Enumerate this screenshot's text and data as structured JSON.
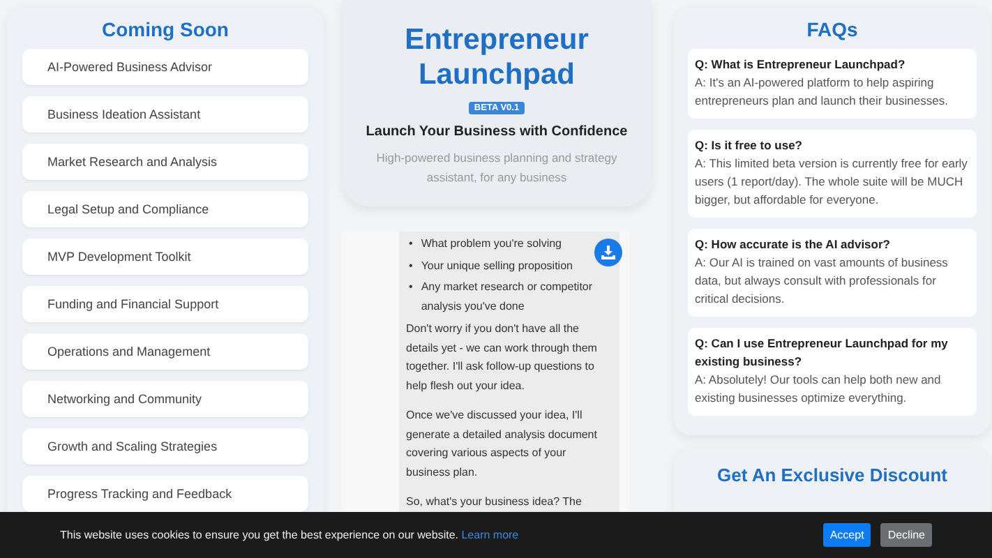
{
  "coming_soon": {
    "title": "Coming Soon",
    "items": [
      "AI-Powered Business Advisor",
      "Business Ideation Assistant",
      "Market Research and Analysis",
      "Legal Setup and Compliance",
      "MVP Development Toolkit",
      "Funding and Financial Support",
      "Operations and Management",
      "Networking and Community",
      "Growth and Scaling Strategies",
      "Progress Tracking and Feedback"
    ]
  },
  "hero": {
    "title": "Entrepreneur Launchpad",
    "badge": "BETA V0.1",
    "tagline": "Launch Your Business with Confidence",
    "subtitle": "High-powered business planning and strategy assistant, for any business"
  },
  "chat": {
    "message": {
      "bullets": [
        {
          "marker": "•",
          "text": "What problem you're solving"
        },
        {
          "marker": "•",
          "text": "Your unique selling proposition"
        },
        {
          "marker": "•",
          "text": "Any market research or competitor analysis you've done"
        }
      ],
      "paragraphs": [
        "Don't worry if you don't have all the details yet - we can work through them together. I'll ask follow-up questions to help flesh out your idea.",
        "Once we've discussed your idea, I'll generate a detailed analysis document covering various aspects of your business plan.",
        "So, what's your business idea? The"
      ]
    }
  },
  "faqs": {
    "title": "FAQs",
    "items": [
      {
        "question": "Q: What is Entrepreneur Launchpad?",
        "answer": "A: It's an AI-powered platform to help aspiring entrepreneurs plan and launch their businesses."
      },
      {
        "question": "Q: Is it free to use?",
        "answer": "A: This limited beta version is currently free for early users (1 report/day). The whole suite will be MUCH bigger, but affordable for everyone."
      },
      {
        "question": "Q: How accurate is the AI advisor?",
        "answer": "A: Our AI is trained on vast amounts of business data, but always consult with professionals for critical decisions."
      },
      {
        "question": "Q: Can I use Entrepreneur Launchpad for my existing business?",
        "answer": "A: Absolutely! Our tools can help both new and existing businesses optimize everything."
      }
    ]
  },
  "discount": {
    "title": "Get An Exclusive Discount"
  },
  "cookie_banner": {
    "text": "This website uses cookies to ensure you get the best experience on our website.",
    "link": "Learn more",
    "buttons": [
      {
        "label": "Accept",
        "kind": "primary"
      },
      {
        "label": "Decline",
        "kind": "secondary"
      }
    ]
  }
}
